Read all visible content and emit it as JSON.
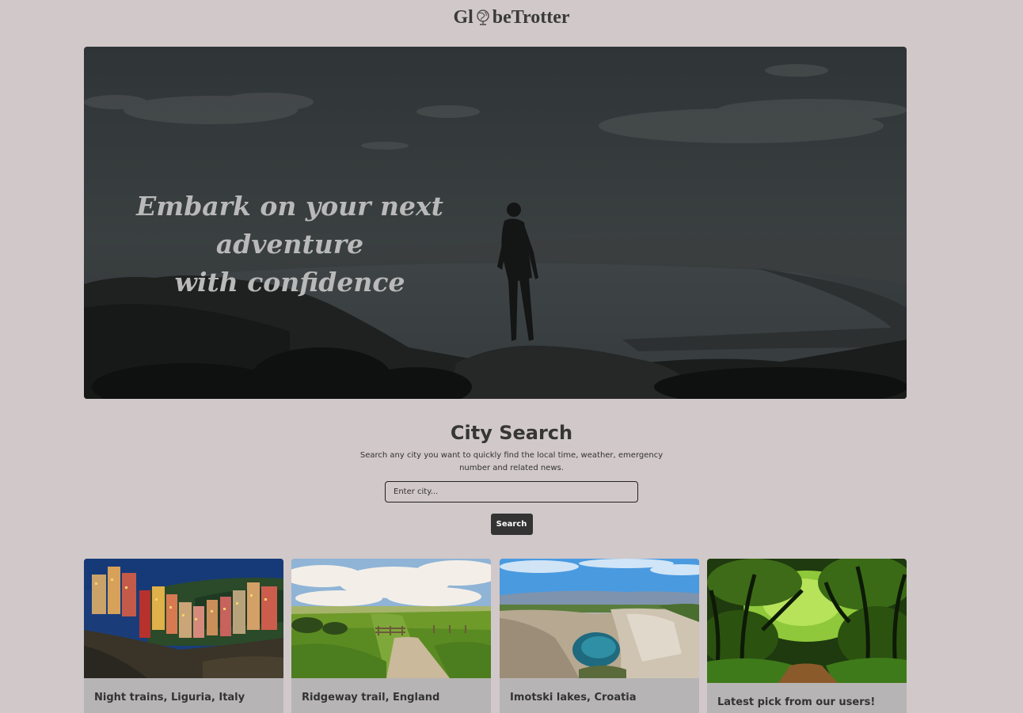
{
  "header": {
    "logo_before": "Gl",
    "logo_after": "beTrotter",
    "logo_icon": "globe-icon"
  },
  "hero": {
    "title_line1": "Embark on your next adventure",
    "title_line2": "with confidence"
  },
  "search": {
    "title": "City Search",
    "description": "Search any city you want to quickly find the local time, weather, emergency number and related news.",
    "placeholder": "Enter city...",
    "button_label": "Search"
  },
  "cards": [
    {
      "title": "Night trains, Liguria, Italy"
    },
    {
      "title": "Ridgeway trail, England"
    },
    {
      "title": "Imotski lakes, Croatia"
    },
    {
      "title": "Latest pick from our users!"
    }
  ],
  "colors": {
    "page_background": "#d1c8c9",
    "button_background": "#333333",
    "card_background": "#b6b4b4"
  }
}
